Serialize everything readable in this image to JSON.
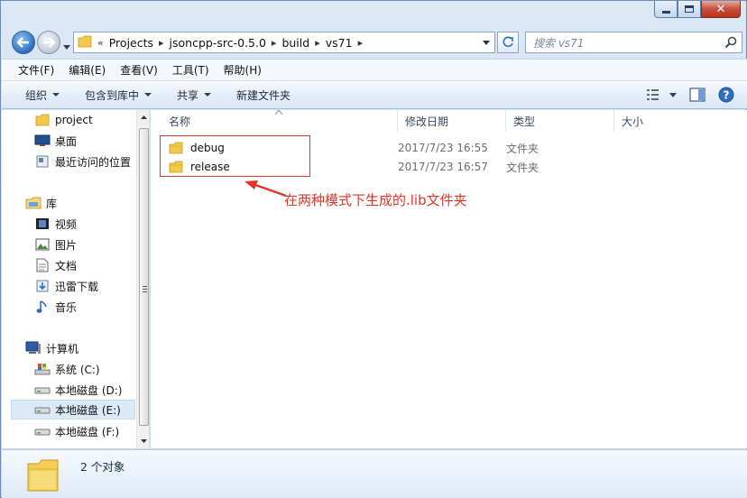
{
  "window": {
    "controls": {
      "minimize": "minimize",
      "maximize": "maximize",
      "close": "close"
    }
  },
  "address_bar": {
    "prefix": "«",
    "crumbs": [
      "Projects",
      "jsoncpp-src-0.5.0",
      "build",
      "vs71"
    ]
  },
  "search": {
    "placeholder": "搜索 vs71"
  },
  "menu": {
    "items": [
      "文件(F)",
      "编辑(E)",
      "查看(V)",
      "工具(T)",
      "帮助(H)"
    ]
  },
  "toolbar": {
    "organize": "组织",
    "include_in_library": "包含到库中",
    "share": "共享",
    "new_folder": "新建文件夹"
  },
  "navigation": {
    "favorites": [
      {
        "label": "project",
        "icon": "folder-icon"
      },
      {
        "label": "桌面",
        "icon": "desktop-icon"
      },
      {
        "label": "最近访问的位置",
        "icon": "recent-places-icon"
      }
    ],
    "libraries_label": "库",
    "libraries": [
      {
        "label": "视频",
        "icon": "video-icon"
      },
      {
        "label": "图片",
        "icon": "pictures-icon"
      },
      {
        "label": "文档",
        "icon": "documents-icon"
      },
      {
        "label": "迅雷下载",
        "icon": "download-icon"
      },
      {
        "label": "音乐",
        "icon": "music-icon"
      }
    ],
    "computer_label": "计算机",
    "drives": [
      {
        "label": "系统 (C:)",
        "icon": "system-drive-icon"
      },
      {
        "label": "本地磁盘 (D:)",
        "icon": "drive-icon"
      },
      {
        "label": "本地磁盘 (E:)",
        "icon": "drive-icon",
        "selected": true
      },
      {
        "label": "本地磁盘 (F:)",
        "icon": "drive-icon"
      }
    ]
  },
  "columns": [
    "名称",
    "修改日期",
    "类型",
    "大小"
  ],
  "files": [
    {
      "name": "debug",
      "modified": "2017/7/23 16:55",
      "type": "文件夹",
      "size": ""
    },
    {
      "name": "release",
      "modified": "2017/7/23 16:57",
      "type": "文件夹",
      "size": ""
    }
  ],
  "annotation": {
    "text": "在两种模式下生成的.lib文件夹",
    "color": "#e0362a"
  },
  "status": {
    "item_count": "2 个对象"
  }
}
